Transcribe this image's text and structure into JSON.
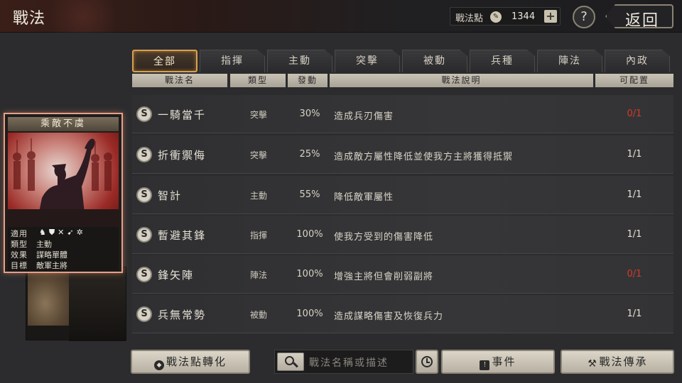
{
  "header": {
    "title": "戰法",
    "points_label": "戰法點",
    "points_value": "1344",
    "plus_label": "+",
    "help_label": "?",
    "back_label": "返回"
  },
  "tabs": [
    {
      "label": "全部",
      "active": true
    },
    {
      "label": "指揮",
      "active": false
    },
    {
      "label": "主動",
      "active": false
    },
    {
      "label": "突擊",
      "active": false
    },
    {
      "label": "被動",
      "active": false
    },
    {
      "label": "兵種",
      "active": false
    },
    {
      "label": "陣法",
      "active": false
    },
    {
      "label": "內政",
      "active": false
    }
  ],
  "columns": {
    "name": "戰法名",
    "type": "類型",
    "rate": "發動",
    "desc": "戰法說明",
    "slot": "可配置"
  },
  "rows": [
    {
      "grade": "S",
      "name": "一騎當千",
      "type": "突擊",
      "rate": "30%",
      "desc": "造成兵刃傷害",
      "slot": "0/1",
      "slot_red": true
    },
    {
      "grade": "S",
      "name": "折衝禦侮",
      "type": "突擊",
      "rate": "25%",
      "desc": "造成敵方屬性降低並使我方主將獲得抵禦",
      "slot": "1/1",
      "slot_red": false
    },
    {
      "grade": "S",
      "name": "智計",
      "type": "主動",
      "rate": "55%",
      "desc": "降低敵軍屬性",
      "slot": "1/1",
      "slot_red": false
    },
    {
      "grade": "S",
      "name": "暫避其鋒",
      "type": "指揮",
      "rate": "100%",
      "desc": "使我方受到的傷害降低",
      "slot": "1/1",
      "slot_red": false
    },
    {
      "grade": "S",
      "name": "鋒矢陣",
      "type": "陣法",
      "rate": "100%",
      "desc": "增強主將但會削弱副將",
      "slot": "0/1",
      "slot_red": true
    },
    {
      "grade": "S",
      "name": "兵無常勢",
      "type": "被動",
      "rate": "100%",
      "desc": "造成謀略傷害及恢復兵力",
      "slot": "1/1",
      "slot_red": false
    }
  ],
  "card": {
    "title": "乘敵不虞",
    "applies_label": "適用",
    "type_label": "類型",
    "type_value": "主動",
    "effect_label": "效果",
    "effect_value": "謀略單體",
    "target_label": "目標",
    "target_value": "敵軍主將"
  },
  "bottom": {
    "convert_label": "戰法點轉化",
    "search_placeholder": "戰法名稱或描述",
    "events_label": "事件",
    "inherit_label": "戰法傳承"
  },
  "colors": {
    "accent_tab": "#d8a050",
    "slot_red": "#d23a2c",
    "card_border": "#e6a08a"
  }
}
